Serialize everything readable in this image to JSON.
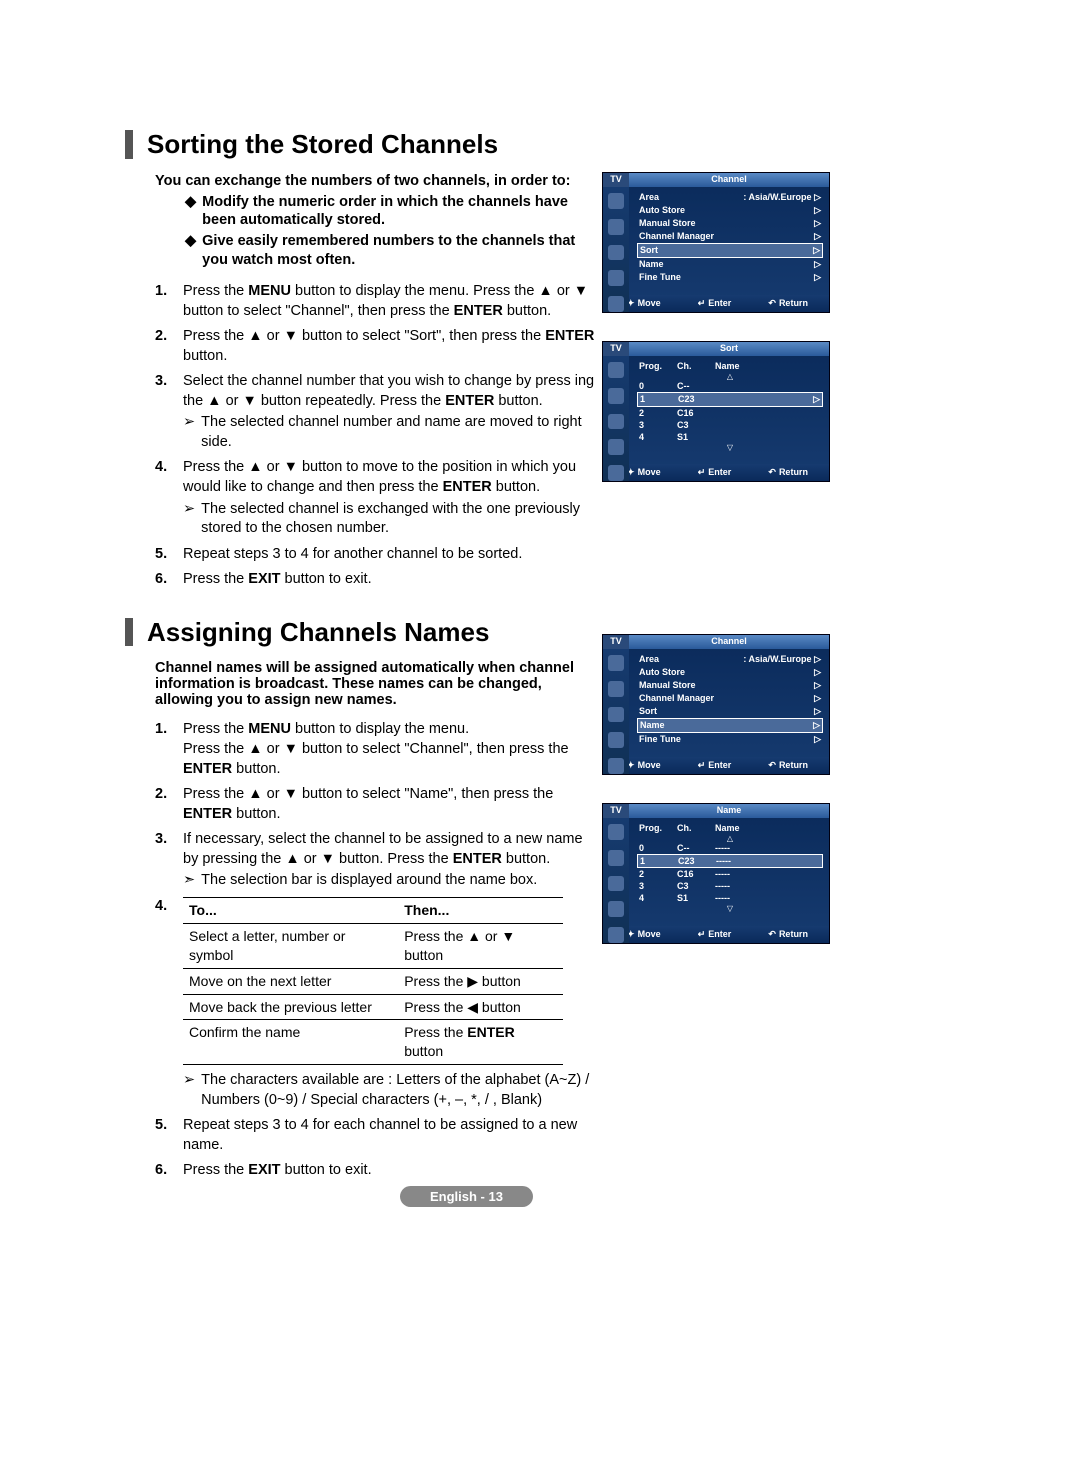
{
  "section1": {
    "title": "Sorting the Stored Channels",
    "intro": "You can exchange the numbers of two channels, in order to:",
    "bullets": [
      "Modify the numeric order in which the channels have been automatically stored.",
      "Give easily remembered numbers to the channels that you watch most often."
    ],
    "steps": {
      "s1a": "Press the ",
      "s1b": " button to display the menu.  Press the ▲ or ▼ button to select \"Channel\", then press the ",
      "s1c": " button.",
      "s1menu": "MENU",
      "s1enter": "ENTER",
      "s2a": "Press the ▲ or ▼ button to select \"Sort\", then press the ",
      "s2b": " button.",
      "s2enter": "ENTER",
      "s3a": "Select the channel number that you wish to change by press ing the ▲ or ▼ button repeatedly. Press the ",
      "s3b": " button.",
      "s3enter": "ENTER",
      "s3sub": "The selected channel number and name are moved to right side.",
      "s4a": "Press the ▲ or ▼ button to move to the position in which you would like to change and then press the ",
      "s4b": " button.",
      "s4enter": "ENTER",
      "s4sub": "The selected channel is exchanged with the one previously stored to the chosen number.",
      "s5": "Repeat steps 3 to 4 for another channel to be sorted.",
      "s6a": "Press the ",
      "s6b": " button to exit.",
      "s6exit": "EXIT"
    }
  },
  "section2": {
    "title": "Assigning Channels Names",
    "intro": "Channel names will be assigned automatically when channel information is broadcast. These names can be changed, allowing you to assign new names.",
    "steps": {
      "s1a": "Press the ",
      "s1menu": "MENU",
      "s1b": " button to display the menu.",
      "s1c": "Press the ▲ or ▼ button to select \"Channel\", then press the ",
      "s1enter": "ENTER",
      "s1d": " button.",
      "s2a": "Press the ▲ or ▼ button to select \"Name\", then press the ",
      "s2enter": "ENTER",
      "s2b": " button.",
      "s3a": "If necessary, select the channel to be assigned to a new name by pressing the ▲ or ▼ button. Press the ",
      "s3enter": "ENTER",
      "s3b": " button.",
      "s3sub": "The selection bar is displayed around the name box.",
      "table": {
        "h1": "To...",
        "h2": "Then...",
        "rows": [
          {
            "to": "Select a letter, number or symbol",
            "then": "Press the ▲ or ▼ button"
          },
          {
            "to": "Move on the next letter",
            "then": "Press the ▶ button"
          },
          {
            "to": "Move back the previous letter",
            "then": "Press the ◀ button"
          },
          {
            "to": "Confirm the name",
            "then_a": "Press the ",
            "then_b": "ENTER",
            "then_c": " button"
          }
        ]
      },
      "s4sub": "The characters available are : Letters of the alphabet (A~Z) / Numbers (0~9) / Special characters (+, –, *, / , Blank)",
      "s5": "Repeat steps 3 to 4 for each channel to be assigned to a new name.",
      "s6a": "Press the ",
      "s6exit": "EXIT",
      "s6b": " button to exit."
    }
  },
  "osd": {
    "tv": "TV",
    "channel_title": "Channel",
    "sort_title": "Sort",
    "name_title": "Name",
    "area": "Area",
    "area_val": ": Asia/W.Europe",
    "auto_store": "Auto Store",
    "manual_store": "Manual Store",
    "channel_manager": "Channel Manager",
    "sort": "Sort",
    "name": "Name",
    "fine_tune": "Fine Tune",
    "move": "Move",
    "enter": "Enter",
    "return": "Return",
    "prog": "Prog.",
    "ch": "Ch.",
    "name_col": "Name",
    "rows": [
      {
        "p": "0",
        "c": "C--",
        "n": "-----"
      },
      {
        "p": "1",
        "c": "C23",
        "n": "-----"
      },
      {
        "p": "2",
        "c": "C16",
        "n": "-----"
      },
      {
        "p": "3",
        "c": "C3",
        "n": "-----"
      },
      {
        "p": "4",
        "c": "S1",
        "n": "-----"
      }
    ]
  },
  "footer": "English - 13"
}
